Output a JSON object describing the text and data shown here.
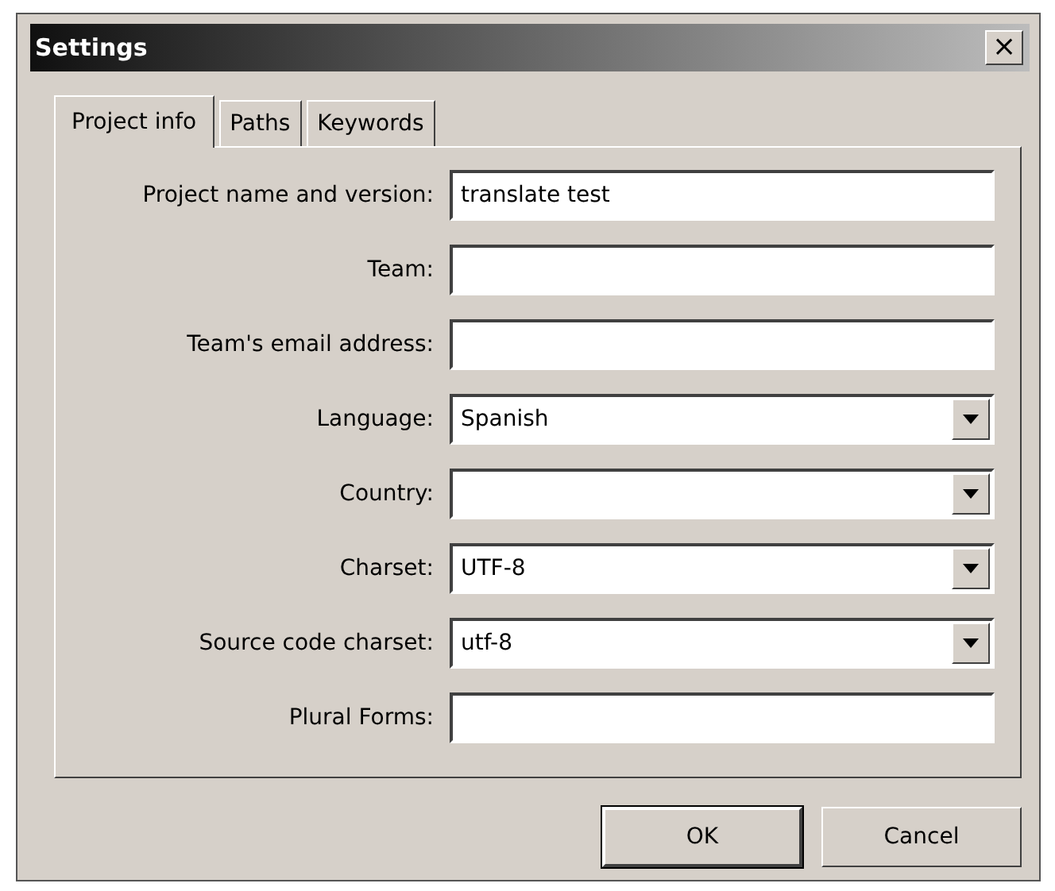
{
  "window": {
    "title": "Settings",
    "close": "×"
  },
  "tabs": [
    {
      "label": "Project info",
      "selected": true
    },
    {
      "label": "Paths",
      "selected": false
    },
    {
      "label": "Keywords",
      "selected": false
    }
  ],
  "fields": [
    {
      "label": "Project name and version:",
      "kind": "text",
      "value": "translate test"
    },
    {
      "label": "Team:",
      "kind": "text"
    },
    {
      "label": "Team's email address:",
      "kind": "text"
    },
    {
      "label": "Language:",
      "kind": "dropdown",
      "value": "Spanish"
    },
    {
      "label": "Country:",
      "kind": "dropdown"
    },
    {
      "label": "Charset:",
      "kind": "dropdown",
      "value": "UTF-8"
    },
    {
      "label": "Source code charset:",
      "kind": "dropdown",
      "value": "utf-8"
    },
    {
      "label": "Plural Forms:",
      "kind": "text"
    }
  ],
  "buttons": [
    {
      "label": "OK",
      "default": true
    },
    {
      "label": "Cancel",
      "default": false
    }
  ]
}
